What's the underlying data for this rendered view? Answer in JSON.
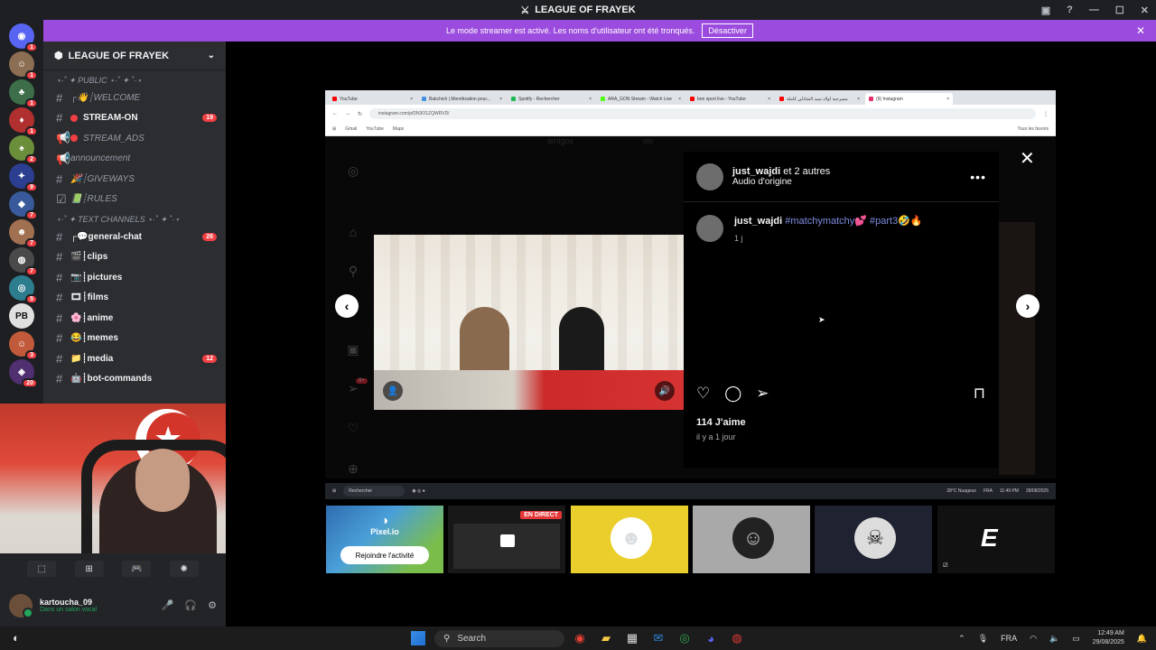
{
  "window": {
    "title": "LEAGUE OF FRAYEK"
  },
  "banner": {
    "text": "Le mode streamer est activé. Les noms d'utilisateur ont été tronqués.",
    "button": "Désactiver"
  },
  "servers": [
    {
      "badge": "1",
      "color": "#5865f2",
      "glyph": "◉"
    },
    {
      "badge": "1",
      "color": "#8c6e52",
      "glyph": "☺"
    },
    {
      "badge": "1",
      "color": "#3c6e4a",
      "glyph": "♣"
    },
    {
      "badge": "1",
      "color": "#b03030",
      "glyph": "♦"
    },
    {
      "badge": "2",
      "color": "#6a8e3a",
      "glyph": "♠"
    },
    {
      "badge": "9",
      "color": "#2c3e8f",
      "glyph": "✦"
    },
    {
      "badge": "7",
      "color": "#385a9a",
      "glyph": "◆"
    },
    {
      "badge": "7",
      "color": "#a07050",
      "glyph": "☻"
    },
    {
      "badge": "7",
      "color": "#4a4a4a",
      "glyph": "◍"
    },
    {
      "badge": "5",
      "color": "#2e7d8f",
      "glyph": "◎"
    },
    {
      "badge": "",
      "color": "#e0e0e0",
      "glyph": "PB"
    },
    {
      "badge": "3",
      "color": "#c05a3a",
      "glyph": "☺"
    },
    {
      "badge": "20",
      "color": "#503070",
      "glyph": "◈"
    }
  ],
  "guild": {
    "name": "LEAGUE OF FRAYEK"
  },
  "categories": {
    "public": "⋆·˚ ✦ PUBLIC ⋆·˚ ✦ ˚·⋆",
    "text": "⋆·˚ ✦ TEXT CHANNELS ⋆·˚ ✦ ˚·⋆"
  },
  "channels_public": [
    {
      "icon": "#",
      "name": "┌👋┊WELCOME",
      "count": "",
      "bold": false,
      "dot": false
    },
    {
      "icon": "#",
      "name": "STREAM-ON",
      "count": "19",
      "bold": true,
      "dot": true
    },
    {
      "icon": "📢",
      "name": "STREAM_ADS",
      "count": "",
      "bold": false,
      "dot": true
    },
    {
      "icon": "📢",
      "name": "announcement",
      "count": "",
      "bold": false,
      "dot": false
    },
    {
      "icon": "#",
      "name": "🎉┊GIVEWAYS",
      "count": "",
      "bold": false,
      "dot": false
    },
    {
      "icon": "☑",
      "name": "📗┊RULES",
      "count": "",
      "bold": false,
      "dot": false
    }
  ],
  "channels_text": [
    {
      "icon": "#",
      "name": "┌💬general-chat",
      "count": "26",
      "bold": true
    },
    {
      "icon": "#",
      "name": "🎬┊clips",
      "count": "",
      "bold": true
    },
    {
      "icon": "#",
      "name": "📷┊pictures",
      "count": "",
      "bold": true
    },
    {
      "icon": "#",
      "name": "🎞┊films",
      "count": "",
      "bold": true
    },
    {
      "icon": "#",
      "name": "🌸┊anime",
      "count": "",
      "bold": true
    },
    {
      "icon": "#",
      "name": "😂┊memes",
      "count": "",
      "bold": true
    },
    {
      "icon": "#",
      "name": "📁┊media",
      "count": "12",
      "bold": true
    },
    {
      "icon": "#",
      "name": "🤖┊bot-commands",
      "count": "",
      "bold": true
    }
  ],
  "user": {
    "name": "kartoucha_09",
    "status": "Dans un salon vocal"
  },
  "browser": {
    "tabs": [
      {
        "label": "YouTube",
        "color": "#ff0000"
      },
      {
        "label": "Bakchich | Monétisation pour...",
        "color": "#4a90e2"
      },
      {
        "label": "Spotify - Rechercher",
        "color": "#1db954"
      },
      {
        "label": "ARA_GON Stream - Watch Live",
        "color": "#53fc18"
      },
      {
        "label": "bon sport live - YouTube",
        "color": "#ff0000"
      },
      {
        "label": "مسرحية أولاد سيد الشاذلي كاملة",
        "color": "#ff0000"
      },
      {
        "label": "(9) Instagram",
        "color": "#e1306c"
      }
    ],
    "url": "instagram.com/p/DN3O1ZQWRVD/",
    "bookmarks": [
      "Gmail",
      "YouTube",
      "Maps"
    ],
    "all_favs": "Tous les favoris"
  },
  "instagram": {
    "ghost_left": "amigos",
    "ghost_right": "sis",
    "header_user": "just_wajdi",
    "header_others": "et 2 autres",
    "audio": "Audio d'origine",
    "caption_user": "just_wajdi",
    "caption_tags": "#matchymatchy💕 #part3🤣🔥",
    "caption_age": "1 j",
    "likes": "114 J'aime",
    "date": "il y a 1 jour",
    "notif": "9+"
  },
  "inner_taskbar": {
    "search": "Rechercher",
    "weather": "28°C Nuageux",
    "lang": "FRA",
    "time": "11:49 PM",
    "date": "28/08/2025"
  },
  "activity": {
    "game": "Pixel.io",
    "join": "Rejoindre l'activité",
    "live": "EN DIRECT"
  },
  "taskbar": {
    "search": "Search",
    "lang": "FRA",
    "time": "12:49 AM",
    "date": "29/08/2025"
  }
}
